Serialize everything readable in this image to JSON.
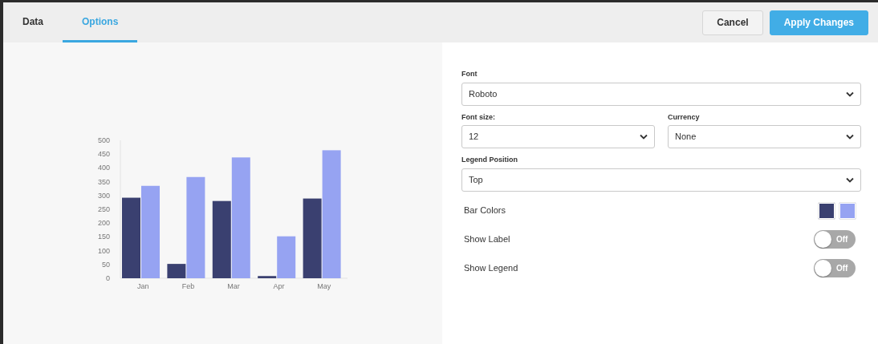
{
  "tabs": [
    {
      "label": "Data",
      "selected": false
    },
    {
      "label": "Options",
      "selected": true
    }
  ],
  "buttons": [
    {
      "label": "Cancel",
      "kind": "secondary"
    },
    {
      "label": "Apply Changes",
      "kind": "primary"
    }
  ],
  "chart": {
    "chart_data": {
      "type": "bar",
      "categories": [
        "Jan",
        "Feb",
        "Mar",
        "Apr",
        "May"
      ],
      "series": [
        {
          "color": "#3a4070",
          "values": [
            292,
            52,
            280,
            8,
            289
          ]
        },
        {
          "color": "#96a3f2",
          "values": [
            335,
            367,
            438,
            152,
            464
          ]
        }
      ],
      "ylim": [
        0,
        500
      ],
      "yticks": [
        0,
        50,
        100,
        150,
        200,
        250,
        300,
        350,
        400,
        450,
        500
      ]
    }
  },
  "options": {
    "field_rows": [
      [
        {
          "label": "Font",
          "value": "Roboto"
        }
      ],
      [
        {
          "label": "Font size:",
          "value": "12"
        },
        {
          "label": "Currency",
          "value": "None"
        }
      ],
      [
        {
          "label": "Legend Position",
          "value": "Top"
        }
      ]
    ],
    "bar_colors": {
      "label": "Bar Colors",
      "swatches": [
        {
          "color": "#3a4070"
        },
        {
          "color": "#96a3f2"
        }
      ]
    },
    "toggles": [
      {
        "label": "Show Label",
        "on": false,
        "state_text": "Off"
      },
      {
        "label": "Show Legend",
        "on": false,
        "state_text": "Off"
      }
    ]
  }
}
